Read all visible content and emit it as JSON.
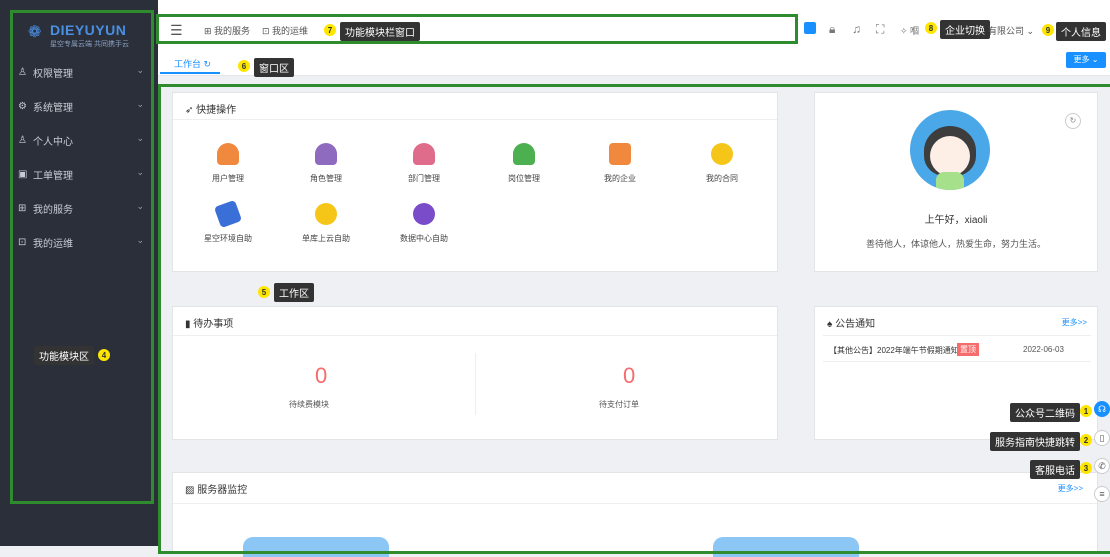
{
  "sidebar": {
    "brand": "DIEYUYUN",
    "brand_sub": "星空专属云端 共同携手云",
    "items": [
      {
        "label": "权限管理",
        "icon": "user-icon"
      },
      {
        "label": "系统管理",
        "icon": "gear-icon"
      },
      {
        "label": "个人中心",
        "icon": "user-icon"
      },
      {
        "label": "工单管理",
        "icon": "clipboard-icon"
      },
      {
        "label": "我的服务",
        "icon": "grid-icon"
      },
      {
        "label": "我的运维",
        "icon": "monitor-icon"
      }
    ],
    "area_label": "功能模块区"
  },
  "topbar": {
    "nav": [
      {
        "label": "我的服务",
        "icon": "grid-icon"
      },
      {
        "label": "我的运维",
        "icon": "monitor-icon"
      }
    ],
    "nav_label": "功能模块栏窗口",
    "company_label": "企业切换",
    "company_name": "有限公司",
    "profile_label": "个人信息"
  },
  "tabs": {
    "active": "工作台",
    "area_label": "窗口区",
    "more": "更多"
  },
  "workspace": {
    "area_label": "工作区",
    "quick_ops": {
      "title": "快捷操作",
      "items": [
        {
          "label": "用户管理",
          "color": "#f0883e"
        },
        {
          "label": "角色管理",
          "color": "#8e6bbf"
        },
        {
          "label": "部门管理",
          "color": "#e06c8c"
        },
        {
          "label": "岗位管理",
          "color": "#4caf50"
        },
        {
          "label": "我的企业",
          "color": "#f0883e"
        },
        {
          "label": "我的合同",
          "color": "#f5c518"
        },
        {
          "label": "星空环境自助",
          "color": "#3a6fd8"
        },
        {
          "label": "单库上云自助",
          "color": "#f5c518"
        },
        {
          "label": "数据中心自助",
          "color": "#7b4cc9"
        }
      ]
    },
    "profile": {
      "greeting": "上午好，xiaoli",
      "motto": "善待他人，体谅他人，热爱生命，努力生活。"
    },
    "todo": {
      "title": "待办事项",
      "items": [
        {
          "value": "0",
          "label": "待续费模块"
        },
        {
          "value": "0",
          "label": "待支付订单"
        }
      ]
    },
    "notice": {
      "title": "公告通知",
      "more": "更多>>",
      "items": [
        {
          "text": "【其他公告】2022年端午节假期通知",
          "badge": "置顶",
          "date": "2022-06-03"
        }
      ]
    },
    "monitor": {
      "title": "服务器监控",
      "more": "更多>>"
    }
  },
  "callouts": {
    "qrcode": "公众号二维码",
    "guide": "服务指南快捷跳转",
    "phone": "客服电话"
  }
}
